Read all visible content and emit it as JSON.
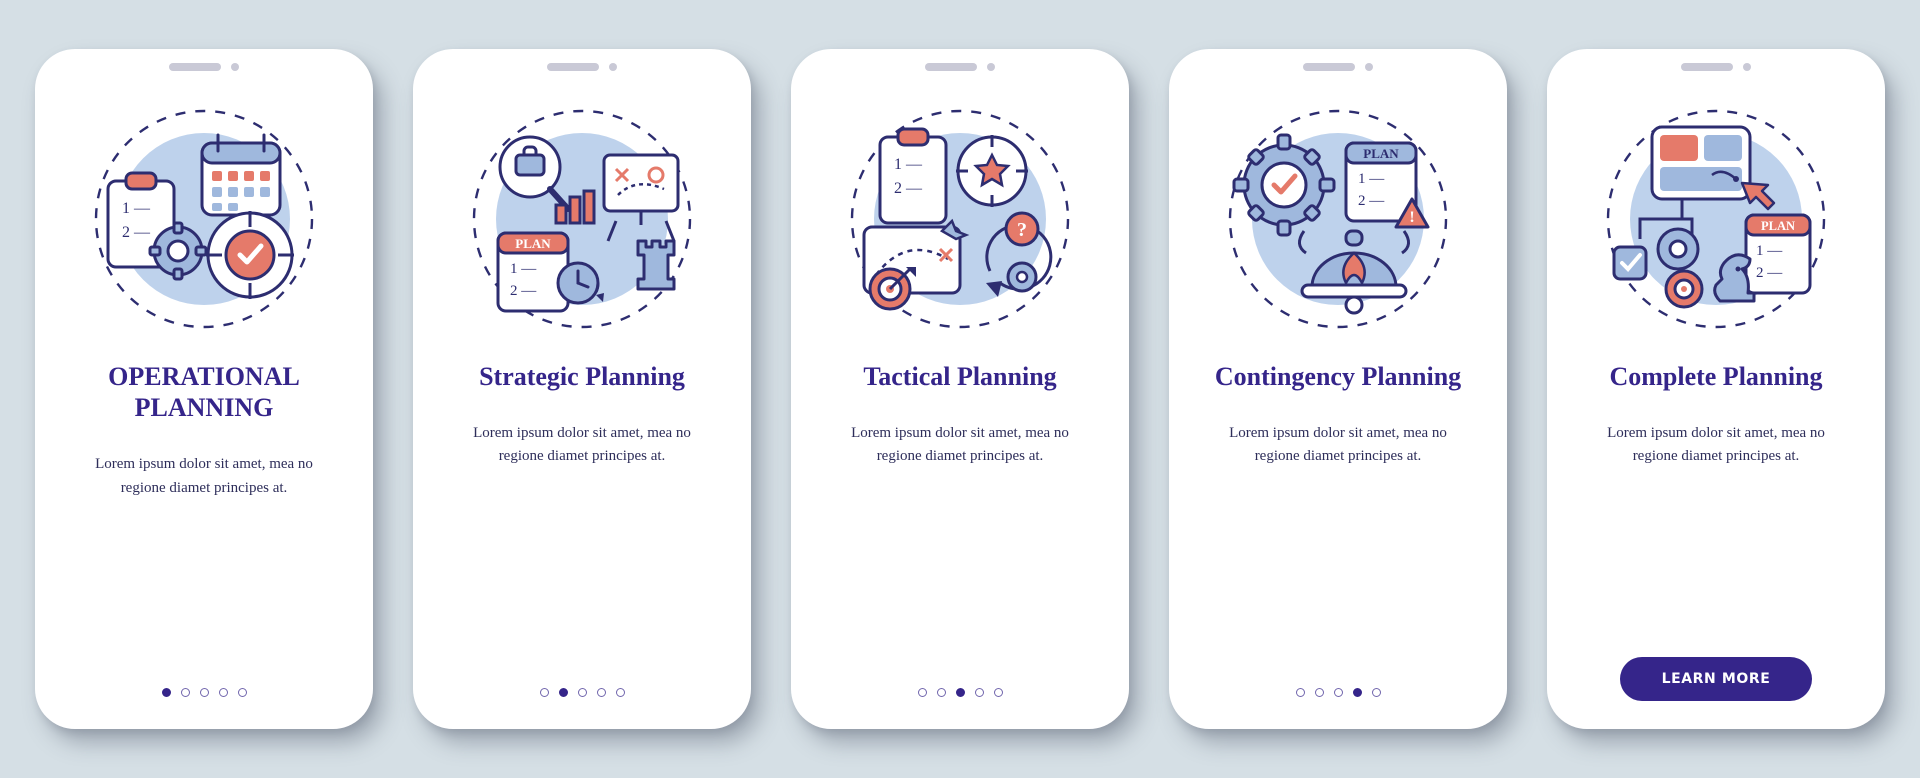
{
  "colors": {
    "accent": "#7a98c9",
    "coral": "#e57a6a",
    "ink": "#35258a",
    "bluefill": "#bed2ec",
    "stroke": "#2d2d70"
  },
  "button_label": "LEARN MORE",
  "screens": [
    {
      "title": "OPERATIONAL PLANNING",
      "desc": "Lorem ipsum dolor sit amet, mea no regione diamet principes at.",
      "icon": "operational-planning-icon",
      "active_dot": 0,
      "plan_label": "",
      "list": [
        "1 —",
        "2 —"
      ]
    },
    {
      "title": "Strategic Planning",
      "desc": "Lorem ipsum dolor sit amet, mea no regione diamet principes at.",
      "icon": "strategic-planning-icon",
      "active_dot": 1,
      "plan_label": "PLAN",
      "list": [
        "1 —",
        "2 —"
      ]
    },
    {
      "title": "Tactical Planning",
      "desc": "Lorem ipsum dolor sit amet, mea no regione diamet principes at.",
      "icon": "tactical-planning-icon",
      "active_dot": 2,
      "plan_label": "",
      "list": [
        "1 —",
        "2 —"
      ]
    },
    {
      "title": "Contingency Planning",
      "desc": "Lorem ipsum dolor sit amet, mea no regione diamet principes at.",
      "icon": "contingency-planning-icon",
      "active_dot": 3,
      "plan_label": "PLAN",
      "list": [
        "1 —",
        "2 —"
      ]
    },
    {
      "title": "Complete Planning",
      "desc": "Lorem ipsum dolor sit amet, mea no regione diamet principes at.",
      "icon": "complete-planning-icon",
      "active_dot": 4,
      "plan_label": "PLAN",
      "list": [
        "1 —",
        "2 —"
      ]
    }
  ]
}
